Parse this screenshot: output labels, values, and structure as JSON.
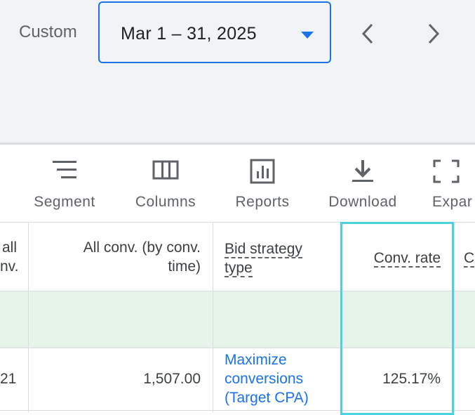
{
  "date_picker": {
    "mode_label": "Custom",
    "range": "Mar 1 – 31, 2025",
    "accent_color": "#1a73e8"
  },
  "toolbar": {
    "segment": "Segment",
    "columns": "Columns",
    "reports": "Reports",
    "download": "Download",
    "expand": "Expar"
  },
  "table": {
    "headers": {
      "all_conv_partial_line1": "all",
      "all_conv_partial_line2": "nv.",
      "all_conv_by_time_line1": "All conv. (by conv.",
      "all_conv_by_time_line2": "time)",
      "bid_strategy_line1": "Bid strategy",
      "bid_strategy_line2": "type",
      "conv_rate": "Conv. rate",
      "next_partial": "C"
    },
    "rows": [
      {
        "all_conv_partial": "21",
        "all_conv_by_time": "1,507.00",
        "bid_strategy_line1": "Maximize",
        "bid_strategy_line2": "conversions",
        "bid_strategy_line3": "(Target CPA)",
        "conv_rate": "125.17%"
      }
    ],
    "highlight_color": "#4dd0e1"
  }
}
